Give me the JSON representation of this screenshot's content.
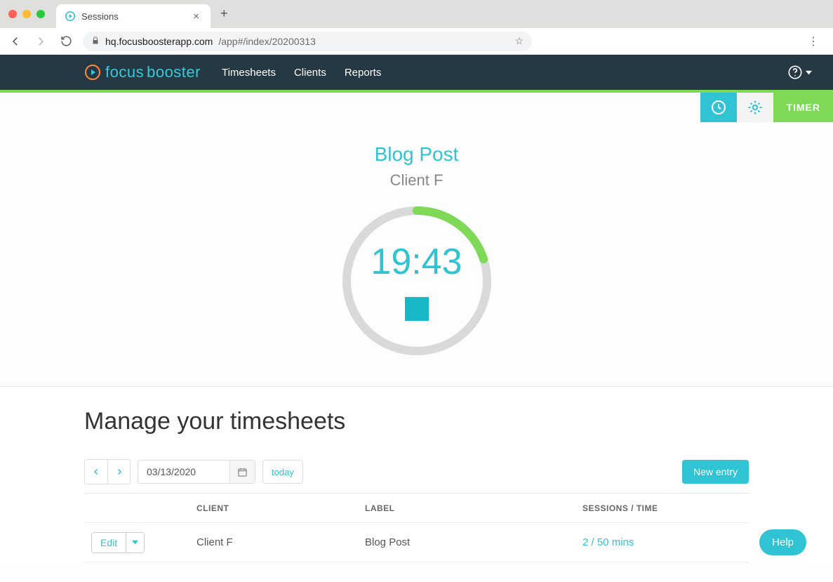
{
  "browser": {
    "tab_title": "Sessions",
    "url_host": "hq.focusboosterapp.com",
    "url_path": "/app#/index/20200313"
  },
  "app": {
    "logo_text1": "focus",
    "logo_text2": "booster",
    "nav": {
      "timesheets": "Timesheets",
      "clients": "Clients",
      "reports": "Reports"
    },
    "timer_label": "TIMER"
  },
  "timer": {
    "session_title": "Blog Post",
    "client": "Client F",
    "elapsed": "19:43",
    "progress_frac": 0.2
  },
  "sheet": {
    "heading": "Manage your timesheets",
    "date": "03/13/2020",
    "today_label": "today",
    "new_entry_label": "New entry",
    "columns": {
      "client": "CLIENT",
      "label": "LABEL",
      "sessions": "SESSIONS / TIME"
    },
    "edit_label": "Edit",
    "rows": [
      {
        "client": "Client F",
        "label": "Blog Post",
        "sessions_time": "2 / 50 mins"
      }
    ]
  },
  "help": {
    "fab": "Help"
  }
}
